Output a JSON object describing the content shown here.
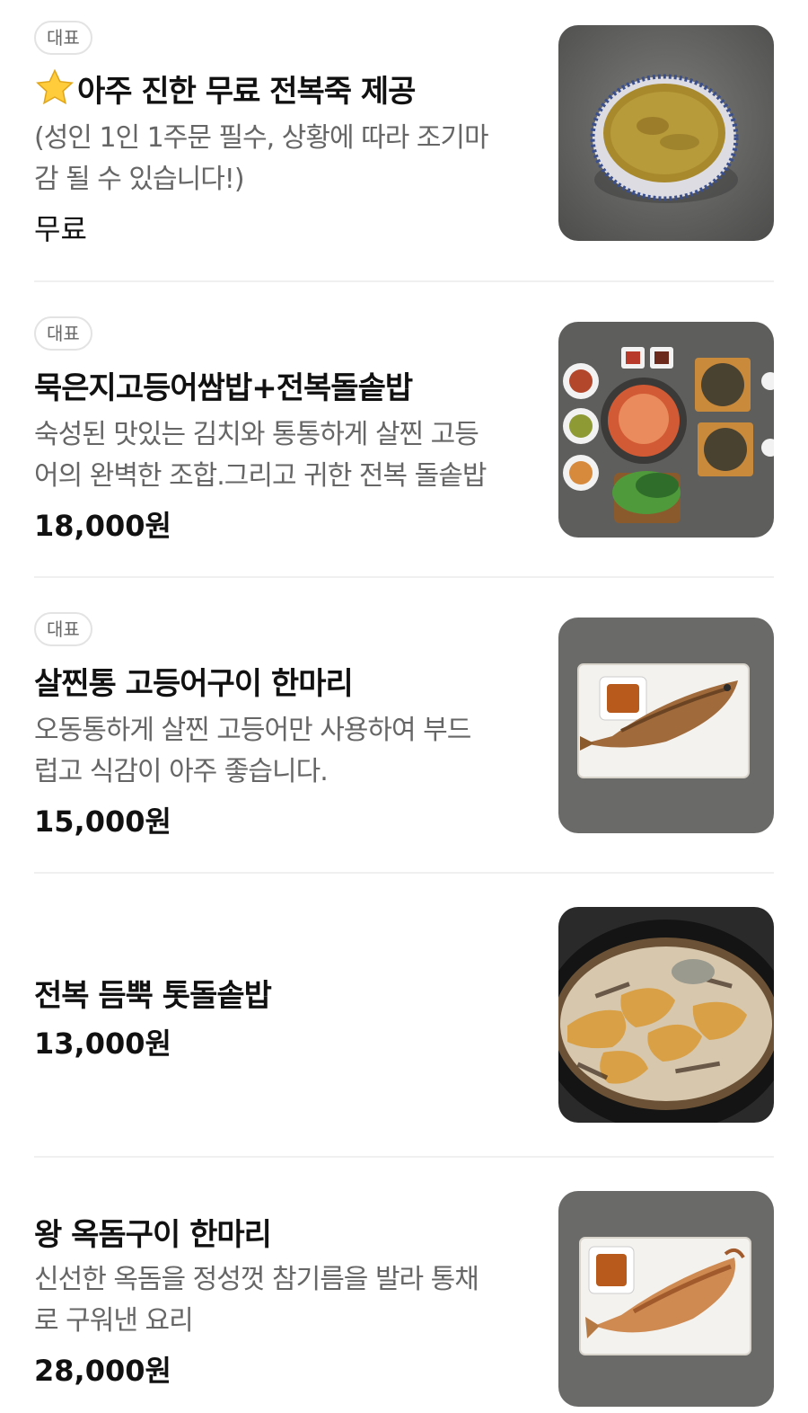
{
  "menu": {
    "items": [
      {
        "badge": "대표",
        "title": "아주 진한 무료 전복죽 제공",
        "desc": "(성인 1인 1주문 필수, 상황에 따라 조기마\n감 될 수 있습니다!)",
        "price": "무료",
        "image": "abalone-porridge-bowl"
      },
      {
        "badge": "대표",
        "title": "묵은지고등어쌈밥+전복돌솥밥",
        "desc": "숙성된 맛있는 김치와 통통하게 살찐 고등\n어의 완벽한 조합.그리고 귀한 전복 돌솥밥",
        "price": "18,000원",
        "image": "mackerel-kimchi-set"
      },
      {
        "badge": "대표",
        "title": "살찐통 고등어구이 한마리",
        "desc": "오동통하게 살찐 고등어만 사용하여 부드\n럽고 식감이 아주 좋습니다.",
        "price": "15,000원",
        "image": "grilled-mackerel-plate"
      },
      {
        "title": "전복 듬뿍 톳돌솥밥",
        "price": "13,000원",
        "image": "abalone-stone-pot-rice"
      },
      {
        "title": "왕 옥돔구이 한마리",
        "desc": "신선한 옥돔을 정성껏 참기름을 발라 통채\n로 구워낸 요리",
        "price": "28,000원",
        "image": "grilled-tilefish-plate"
      }
    ]
  },
  "colors": {
    "accent_text": "#111111",
    "secondary_text": "#666666",
    "badge_border": "#e3e3e3",
    "divider": "#f0f0f0"
  }
}
